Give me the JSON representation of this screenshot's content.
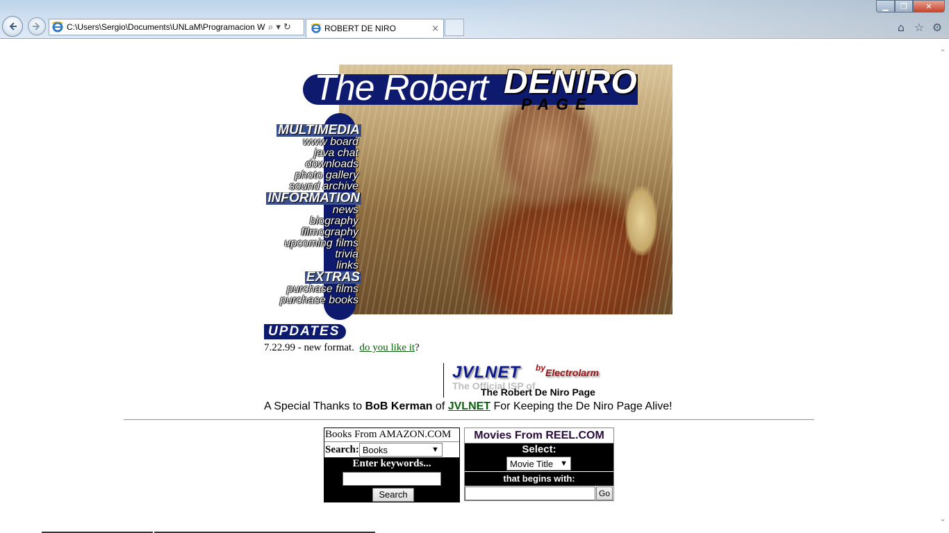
{
  "browser": {
    "address_url": "C:\\Users\\Sergio\\Documents\\UNLaM\\Programacion W",
    "tab_title": "ROBERT DE NIRO",
    "tab_close": "×",
    "search_glyph": "⌕ ▾",
    "refresh_glyph": "↻",
    "win_min": "▁",
    "win_max": "❐",
    "win_close": "✕",
    "home_glyph": "⌂",
    "fav_glyph": "☆",
    "tools_glyph": "⚙",
    "scroll_up": "⌃",
    "scroll_down": "⌄"
  },
  "header": {
    "title_the": "The Robert",
    "title_deniro": "DENIRO",
    "title_page": "PAGE"
  },
  "menu": {
    "multimedia": "MULTIMEDIA",
    "multimedia_items": [
      "www board",
      "java chat",
      "downloads",
      "photo gallery",
      "sound archive"
    ],
    "information": "INFORMATION",
    "information_items": [
      "news",
      "biography",
      "filmography",
      "upcoming films",
      "trivia",
      "links"
    ],
    "extras": "EXTRAS",
    "extras_items": [
      "purchase films",
      "purchase books"
    ]
  },
  "updates": {
    "heading": "UPDATES",
    "text": "7.22.99 - new format.",
    "link": "do you like it",
    "suffix": "?"
  },
  "sponsor": {
    "logo": "JVLNET",
    "by": "by",
    "company": "Electrolarm",
    "isp": "The Official ISP of",
    "page": "The Robert De Niro Page"
  },
  "thanks": {
    "prefix": "A Special Thanks to ",
    "name": "BoB Kerman",
    "mid": " of ",
    "link": "JVLNET",
    "suffix": " For Keeping the De Niro Page Alive!"
  },
  "amazon": {
    "title": "Books From AMAZON.COM",
    "search_label": "Search:",
    "select_value": "Books",
    "keywords_label": "Enter keywords...",
    "button": "Search"
  },
  "reel": {
    "title": "Movies From REEL.COM",
    "select_label": "Select:",
    "select_value": "Movie Title",
    "begins_label": "that begins with:",
    "button": "Go"
  }
}
